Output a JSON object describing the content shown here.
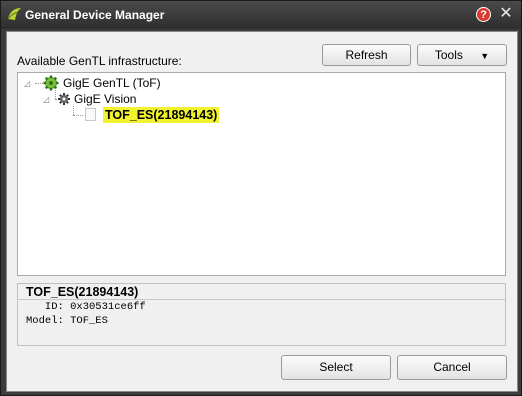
{
  "window": {
    "title": "General Device Manager",
    "help_glyph": "?",
    "close_glyph": "✕"
  },
  "toolbar": {
    "available_label": "Available GenTL infrastructure:",
    "refresh_label": "Refresh",
    "tools_label": "Tools",
    "tools_arrow": "▼"
  },
  "tree": {
    "root": {
      "label": "GigE GenTL (ToF)",
      "icon": "gear-green-icon"
    },
    "child": {
      "label": "GigE Vision",
      "icon": "gear-dark-icon"
    },
    "device": {
      "label": "TOF_ES(21894143)",
      "icon": "device-icon",
      "highlight": "#f2f22e"
    }
  },
  "details": {
    "title": "TOF_ES(21894143)",
    "id_line": "   ID: 0x30531ce6ff",
    "model_line": "Model: TOF_ES"
  },
  "footer": {
    "select_label": "Select",
    "cancel_label": "Cancel"
  }
}
